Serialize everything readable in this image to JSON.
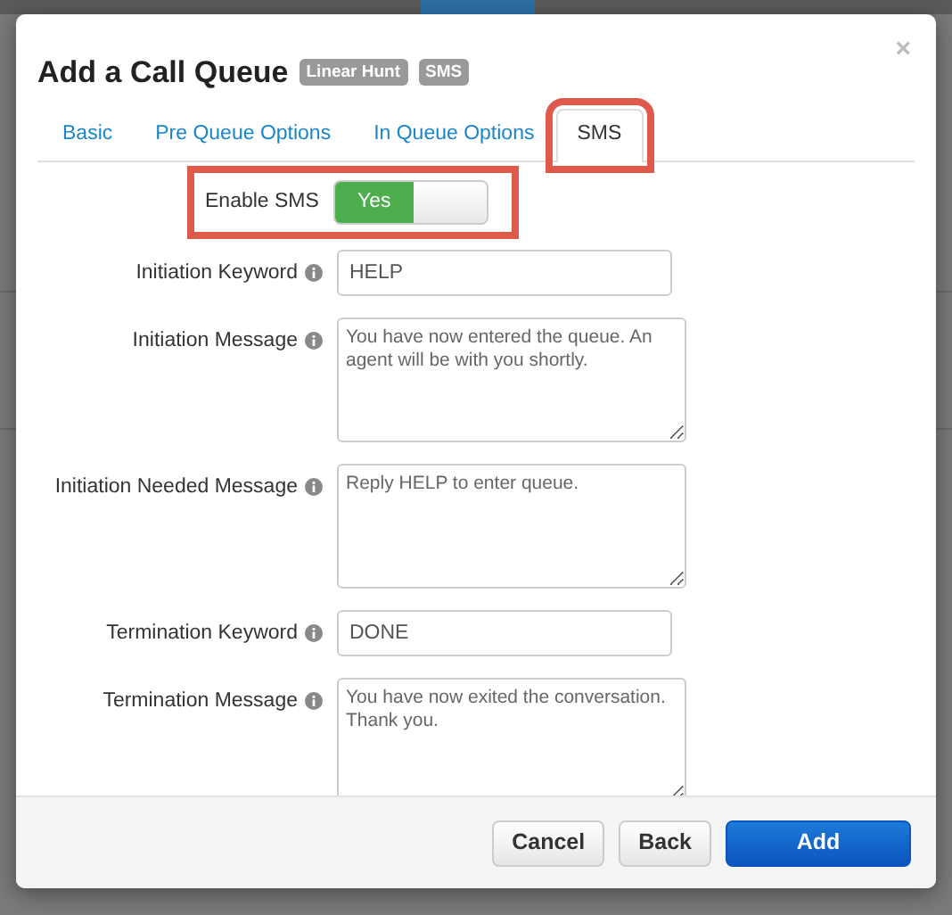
{
  "dialog": {
    "title": "Add a Call Queue",
    "badges": [
      "Linear Hunt",
      "SMS"
    ],
    "close": "×"
  },
  "tabs": [
    {
      "label": "Basic",
      "selected": false,
      "highlighted": false
    },
    {
      "label": "Pre Queue Options",
      "selected": false,
      "highlighted": false
    },
    {
      "label": "In Queue Options",
      "selected": false,
      "highlighted": false
    },
    {
      "label": "SMS",
      "selected": true,
      "highlighted": true
    }
  ],
  "enable": {
    "label": "Enable SMS",
    "on": true,
    "on_text": "Yes",
    "highlighted": true
  },
  "fields": [
    {
      "kind": "input",
      "label": "Initiation Keyword",
      "value": "HELP"
    },
    {
      "kind": "textarea",
      "label": "Initiation Message",
      "value": "You have now entered the queue. An agent will be with you shortly."
    },
    {
      "kind": "textarea",
      "label": "Initiation Needed Message",
      "value": "Reply HELP to enter queue."
    },
    {
      "kind": "input",
      "label": "Termination Keyword",
      "value": "DONE"
    },
    {
      "kind": "textarea",
      "label": "Termination Message",
      "value": "You have now exited the conversation. Thank you."
    }
  ],
  "buttons": [
    {
      "label": "Cancel",
      "kind": "default"
    },
    {
      "label": "Back",
      "kind": "default"
    },
    {
      "label": "Add",
      "kind": "primary"
    }
  ]
}
